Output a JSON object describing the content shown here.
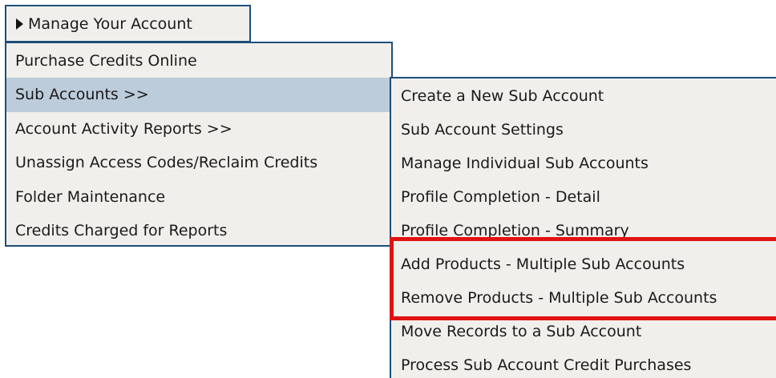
{
  "menu": {
    "title": "Manage Your Account",
    "items": [
      {
        "label": "Purchase Credits Online"
      },
      {
        "label": "Sub Accounts >>"
      },
      {
        "label": "Account Activity Reports >>"
      },
      {
        "label": "Unassign Access Codes/Reclaim Credits"
      },
      {
        "label": "Folder Maintenance"
      },
      {
        "label": "Credits Charged for Reports"
      }
    ]
  },
  "submenu": {
    "items": [
      {
        "label": "Create a New Sub Account"
      },
      {
        "label": "Sub Account Settings"
      },
      {
        "label": "Manage Individual Sub Accounts"
      },
      {
        "label": "Profile Completion - Detail"
      },
      {
        "label": "Profile Completion - Summary"
      },
      {
        "label": "Add Products - Multiple Sub Accounts"
      },
      {
        "label": "Remove Products - Multiple Sub Accounts"
      },
      {
        "label": "Move Records to a Sub Account"
      },
      {
        "label": "Process Sub Account Credit Purchases"
      }
    ]
  },
  "colors": {
    "border": "#1d4f79",
    "menu_bg": "#f1efeb",
    "active_bg": "#bcccdb",
    "highlight": "#e01313"
  }
}
